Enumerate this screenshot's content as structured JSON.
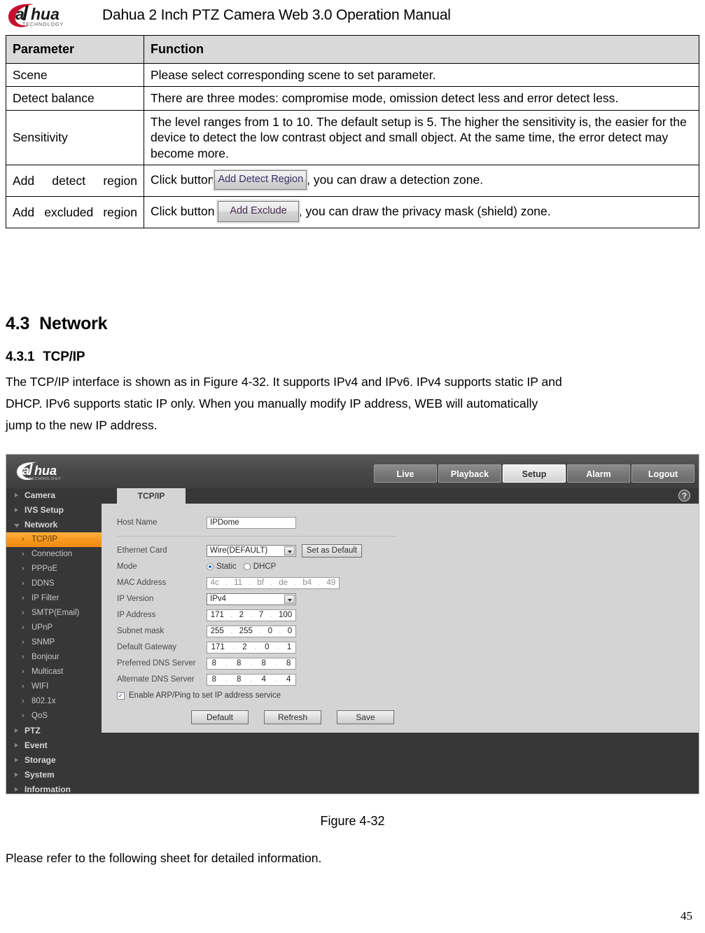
{
  "document": {
    "header_title": "Dahua 2 Inch PTZ Camera Web 3.0 Operation Manual",
    "brand": "alhua",
    "brand_sub": "TECHNOLOGY",
    "page_number": "45"
  },
  "param_table": {
    "headers": [
      "Parameter",
      "Function"
    ],
    "rows": [
      {
        "parameter": "Scene",
        "function": "Please select corresponding scene to set parameter."
      },
      {
        "parameter": "Detect balance",
        "function": "There are three modes: compromise mode, omission detect less and error detect less."
      },
      {
        "parameter": "Sensitivity",
        "function": "The level ranges from 1 to 10. The default setup is 5. The higher the sensitivity is, the easier for the device to detect the low contrast object and small object. At the same time, the error detect may become more."
      },
      {
        "parameter": "Add detect region",
        "function_before": "Click button",
        "button_label": "Add Detect Region",
        "function_after": ", you can draw a detection zone."
      },
      {
        "parameter": "Add excluded region",
        "function_before": "Click button",
        "button_label": "Add Exclude",
        "function_after": ",  you can draw the privacy mask (shield) zone."
      }
    ]
  },
  "sections": {
    "network": {
      "number": "4.3",
      "title": "Network"
    },
    "tcpip": {
      "number": "4.3.1",
      "title": "TCP/IP"
    },
    "intro_line1": "The TCP/IP interface is shown as in Figure 4-32. It supports IPv4 and IPv6. IPv4 supports static IP and",
    "intro_line2": "DHCP. IPv6 supports static IP only. When you manually modify IP address, WEB will automatically",
    "intro_line3": "jump to the new IP address.",
    "figure_caption": "Figure 4-32",
    "closing_text": "Please refer to the following sheet for detailed information."
  },
  "webui": {
    "nav_tabs": [
      {
        "label": "Live",
        "active": false
      },
      {
        "label": "Playback",
        "active": false
      },
      {
        "label": "Setup",
        "active": true
      },
      {
        "label": "Alarm",
        "active": false
      },
      {
        "label": "Logout",
        "active": false
      }
    ],
    "sidebar": [
      {
        "label": "Camera",
        "type": "group",
        "open": false
      },
      {
        "label": "IVS Setup",
        "type": "group",
        "open": false
      },
      {
        "label": "Network",
        "type": "group",
        "open": true
      },
      {
        "label": "TCP/IP",
        "type": "item",
        "active": true
      },
      {
        "label": "Connection",
        "type": "item",
        "active": false
      },
      {
        "label": "PPPoE",
        "type": "item",
        "active": false
      },
      {
        "label": "DDNS",
        "type": "item",
        "active": false
      },
      {
        "label": "IP Filter",
        "type": "item",
        "active": false
      },
      {
        "label": "SMTP(Email)",
        "type": "item",
        "active": false
      },
      {
        "label": "UPnP",
        "type": "item",
        "active": false
      },
      {
        "label": "SNMP",
        "type": "item",
        "active": false
      },
      {
        "label": "Bonjour",
        "type": "item",
        "active": false
      },
      {
        "label": "Multicast",
        "type": "item",
        "active": false
      },
      {
        "label": "WIFI",
        "type": "item",
        "active": false
      },
      {
        "label": "802.1x",
        "type": "item",
        "active": false
      },
      {
        "label": "QoS",
        "type": "item",
        "active": false
      },
      {
        "label": "PTZ",
        "type": "group",
        "open": false
      },
      {
        "label": "Event",
        "type": "group",
        "open": false
      },
      {
        "label": "Storage",
        "type": "group",
        "open": false
      },
      {
        "label": "System",
        "type": "group",
        "open": false
      },
      {
        "label": "Information",
        "type": "group",
        "open": false
      }
    ],
    "content_tab": "TCP/IP",
    "help_icon_glyph": "?",
    "form": {
      "host_name_label": "Host Name",
      "host_name_value": "IPDome",
      "ethernet_card_label": "Ethernet Card",
      "ethernet_card_value": "Wire(DEFAULT)",
      "set_default_label": "Set as Default",
      "mode_label": "Mode",
      "mode_static": "Static",
      "mode_dhcp": "DHCP",
      "mode_selected": "Static",
      "mac_label": "MAC Address",
      "mac_octets": [
        "4c",
        "11",
        "bf",
        "de",
        "b4",
        "49"
      ],
      "ip_version_label": "IP Version",
      "ip_version_value": "IPv4",
      "ip_address_label": "IP Address",
      "ip_address_octets": [
        "171",
        "2",
        "7",
        "100"
      ],
      "subnet_label": "Subnet mask",
      "subnet_octets": [
        "255",
        "255",
        "0",
        "0"
      ],
      "gateway_label": "Default Gateway",
      "gateway_octets": [
        "171",
        "2",
        "0",
        "1"
      ],
      "pref_dns_label": "Preferred DNS Server",
      "pref_dns_octets": [
        "8",
        "8",
        "8",
        "8"
      ],
      "alt_dns_label": "Alternate DNS Server",
      "alt_dns_octets": [
        "8",
        "8",
        "4",
        "4"
      ],
      "arp_ping_label": "Enable ARP/Ping to set IP address service",
      "arp_ping_checked": true,
      "check_glyph": "✓",
      "buttons": [
        "Default",
        "Refresh",
        "Save"
      ]
    }
  },
  "colors": {
    "table_header_bg": "#d9d9d9",
    "accent_orange": "#f79820",
    "webui_dark": "#373737",
    "webui_panel": "#d4d4d4",
    "brand_red": "#c8102e"
  }
}
